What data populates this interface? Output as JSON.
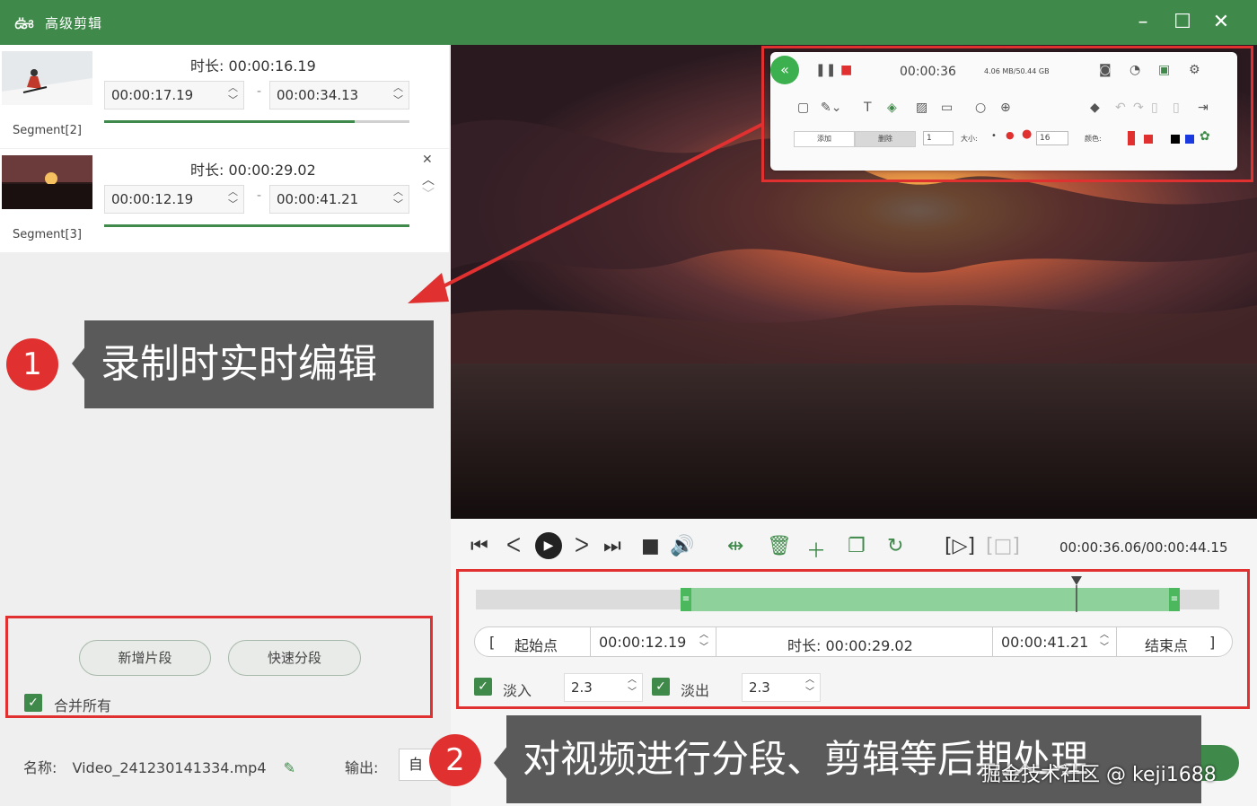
{
  "window": {
    "title": "高级剪辑",
    "logo": "ఊ",
    "min": "–",
    "max": "☐",
    "close": "✕"
  },
  "segments": [
    {
      "label": "Segment[2]",
      "duration": "时长: 00:00:16.19",
      "start": "00:00:17.19",
      "end": "00:00:34.13"
    },
    {
      "label": "Segment[3]",
      "duration": "时长: 00:00:29.02",
      "start": "00:00:12.19",
      "end": "00:00:41.21"
    }
  ],
  "left_actions": {
    "add_segment": "新增片段",
    "quick_split": "快速分段",
    "merge_all": "合并所有"
  },
  "file": {
    "name_label": "名称:",
    "name": "Video_241230141334.mp4",
    "output_label": "输出:",
    "output_value": "自"
  },
  "callouts": [
    {
      "num": "1",
      "text": "录制时实时编辑"
    },
    {
      "num": "2",
      "text": "对视频进行分段、剪辑等后期处理"
    }
  ],
  "recorder": {
    "time": "00:00:36",
    "size": "4.06 MB/50.44 GB",
    "btn_add": "添加",
    "btn_del": "删除",
    "width_value": "1",
    "size_label": "大小:",
    "num_value": "16",
    "color_label": "颜色:"
  },
  "player": {
    "time_readout": "00:00:36.06/00:00:44.15"
  },
  "range": {
    "start_label": "起始点",
    "start": "00:00:12.19",
    "duration": "时长: 00:00:29.02",
    "end": "00:00:41.21",
    "end_label": "结束点"
  },
  "fade": {
    "in_label": "淡入",
    "in_value": "2.3",
    "out_label": "淡出",
    "out_value": "2.3"
  },
  "watermark": "掘金技术社区 @ keji1688",
  "colors": {
    "brand": "#3f8a4a",
    "highlight": "#e03030",
    "track": "#8fd19a"
  }
}
